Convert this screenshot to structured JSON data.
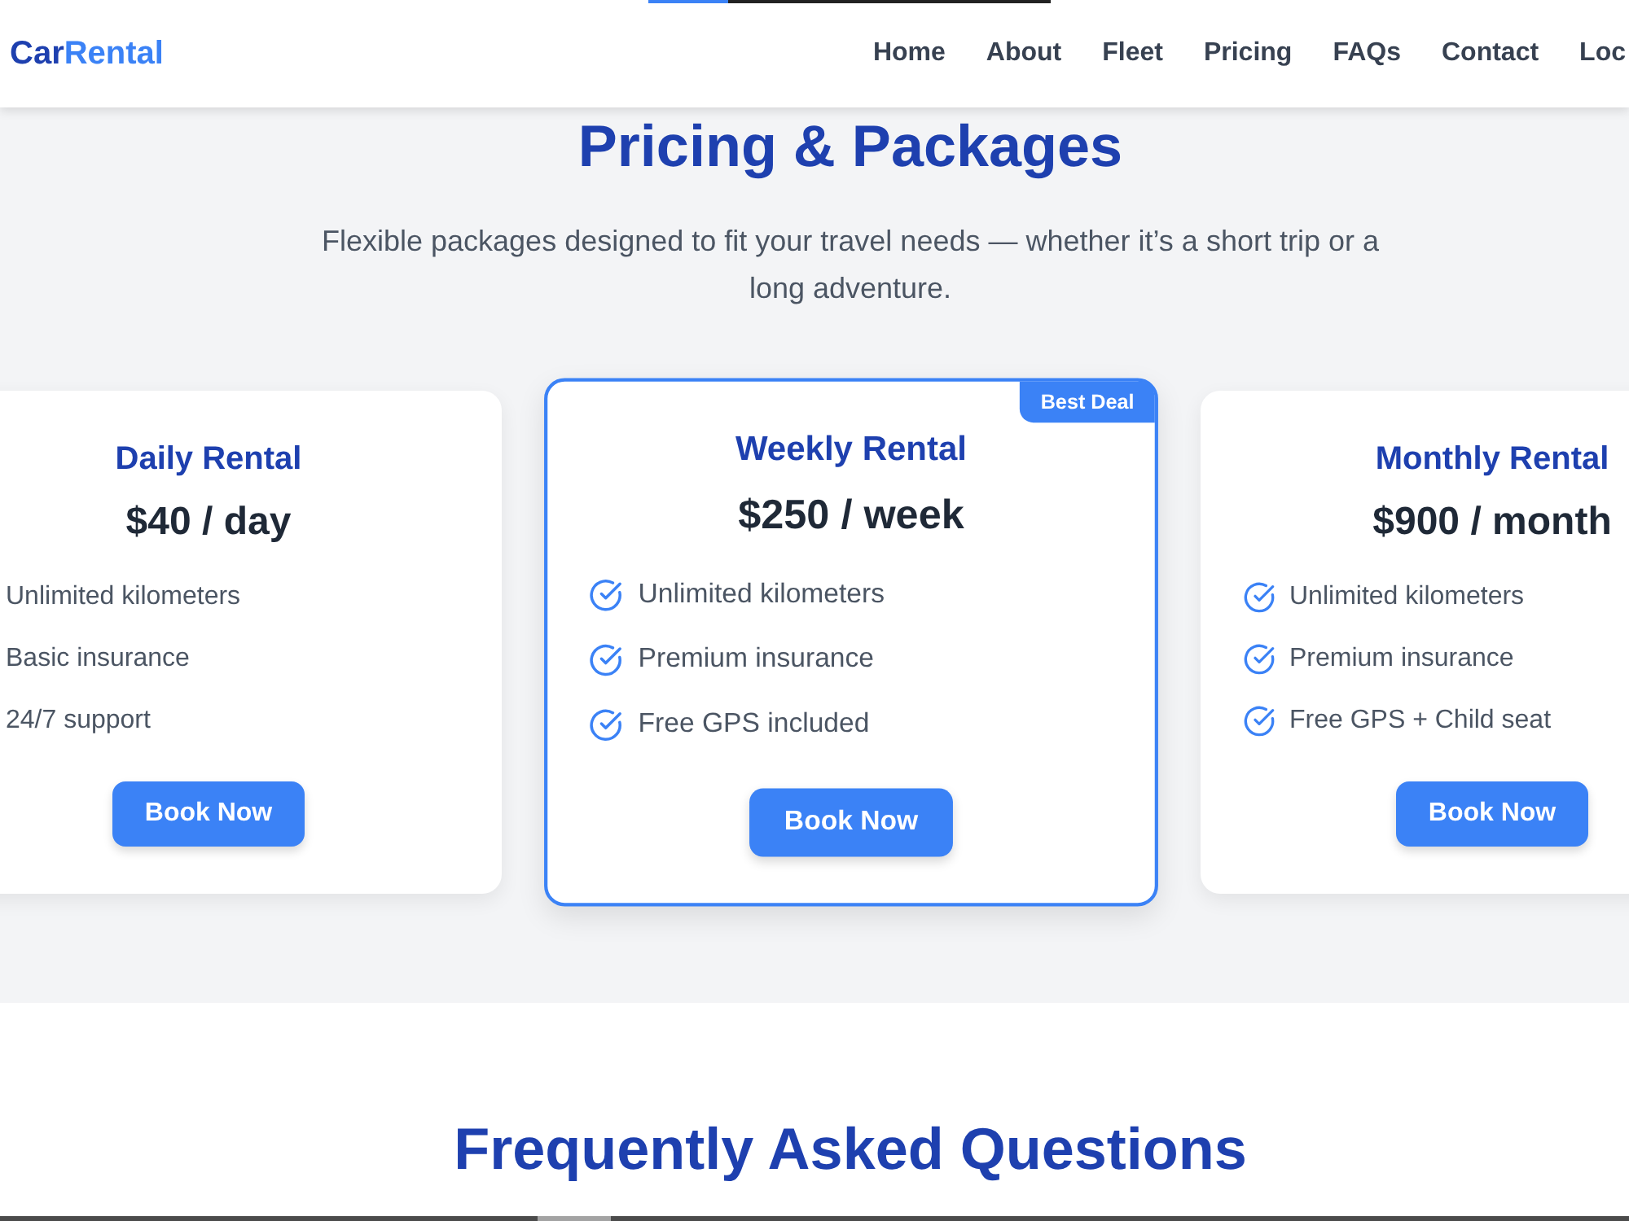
{
  "progress": {
    "level": 0.2
  },
  "header": {
    "logo": {
      "main": "Car",
      "accent": "Rental"
    },
    "nav": [
      "Home",
      "About",
      "Fleet",
      "Pricing",
      "FAQs",
      "Contact",
      "Loc"
    ]
  },
  "pricing": {
    "title": "Pricing & Packages",
    "subtitle": "Flexible packages designed to fit your travel needs — whether it’s a short trip or a long adventure.",
    "plans": [
      {
        "name": "Daily Rental",
        "price": "$40 / day",
        "featured": false,
        "features": [
          "Unlimited kilometers",
          "Basic insurance",
          "24/7 support"
        ],
        "button": "Book Now"
      },
      {
        "name": "Weekly Rental",
        "price": "$250 / week",
        "featured": true,
        "badge": "Best Deal",
        "features": [
          "Unlimited kilometers",
          "Premium insurance",
          "Free GPS included"
        ],
        "button": "Book Now"
      },
      {
        "name": "Monthly Rental",
        "price": "$900 / month",
        "featured": false,
        "features": [
          "Unlimited kilometers",
          "Premium insurance",
          "Free GPS + Child seat"
        ],
        "button": "Book Now"
      }
    ]
  },
  "faq": {
    "title": "Frequently Asked Questions"
  }
}
